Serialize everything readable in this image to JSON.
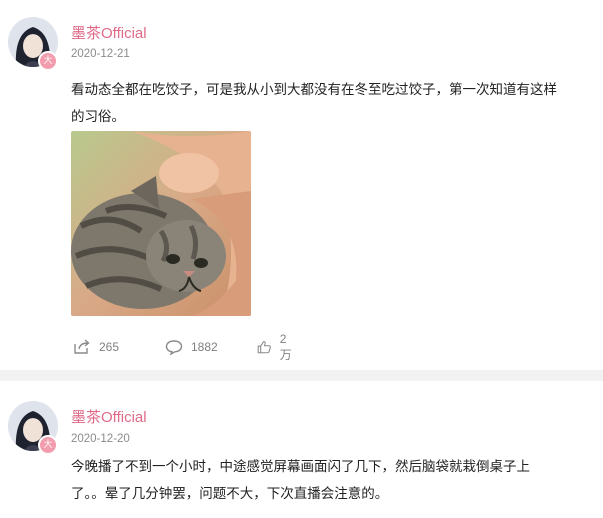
{
  "posts": [
    {
      "username": "墨茶Official",
      "date": "2020-12-21",
      "badge": "大",
      "text": "看动态全都在吃饺子，可是我从小到大都没有在冬至吃过饺子，第一次知道有这样\n的习俗。",
      "image": "kitten-photo",
      "stats": {
        "reposts": "265",
        "comments": "1882",
        "likes": "2万"
      }
    },
    {
      "username": "墨茶Official",
      "date": "2020-12-20",
      "badge": "大",
      "text": "今晚播了不到一个小时，中途感觉屏幕画面闪了几下，然后脑袋就栽倒桌子上\n了。。晕了几分钟罢，问题不大，下次直播会注意的。"
    }
  ],
  "icons": {
    "repost": "repost-icon",
    "comment": "comment-icon",
    "like": "like-icon"
  },
  "colors": {
    "username": "#e06a88",
    "badge": "#f29cad",
    "meta": "#8b8b8b",
    "divider": "#f2f2f2"
  }
}
